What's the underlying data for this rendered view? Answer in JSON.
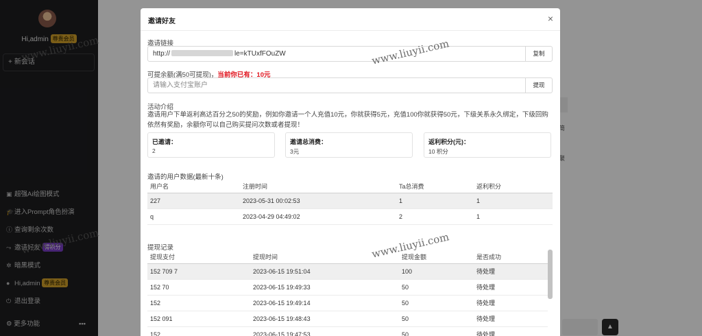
{
  "sidebar": {
    "username": "Hi,admin",
    "user_badge": "尊贵会员",
    "new_chat": "新会话",
    "menu": [
      {
        "icon": "image-icon",
        "glyph": "▣",
        "label": "超强Ai绘图模式"
      },
      {
        "icon": "graduation-cap-icon",
        "glyph": "🎓",
        "label": "进入Prompt角色扮演"
      },
      {
        "icon": "info-icon",
        "glyph": "ⓘ",
        "label": "查询剩余次数"
      },
      {
        "icon": "share-icon",
        "glyph": "⤳",
        "label": "邀请好友",
        "badge": "得积分"
      },
      {
        "icon": "moon-icon",
        "glyph": "✲",
        "label": "暗黑模式"
      },
      {
        "icon": "user-icon",
        "glyph": "●",
        "label": "Hi,admin",
        "badge": "尊贵会员"
      },
      {
        "icon": "power-icon",
        "glyph": "⏻",
        "label": "退出登录"
      }
    ],
    "more": "更多功能",
    "more_dots": "•••"
  },
  "background": {
    "text1": "简",
    "text2": "聚"
  },
  "modal": {
    "title": "邀请好友",
    "close": "×",
    "invite_link_label": "邀请链接",
    "invite_link_prefix": "http://",
    "invite_link_suffix": "le=kTUxfFOuZW",
    "copy_button": "复制",
    "withdraw_label": "可提余额(满50可提现)，",
    "withdraw_current": "当前你已有：10元",
    "alipay_placeholder": "请输入支付宝账户",
    "withdraw_button": "提现",
    "intro_title": "活动介绍",
    "intro_text": "邀请用户下单返利高达百分之50的奖励，例如你邀请一个人充值10元，你就获得5元，充值100你就获得50元，下级关系永久绑定，下级回购依然有奖励，余额你可以自己购买提问次数或者提现！",
    "stats": [
      {
        "title": "已邀请：",
        "value": "2"
      },
      {
        "title": "邀请总消费：",
        "value": "3元"
      },
      {
        "title": "返利积分(元)：",
        "value": "10 积分"
      }
    ],
    "users_title": "邀请的用户数据(最新十条)",
    "users_table": {
      "headers": [
        "用户名",
        "注册时间",
        "Ta总消费",
        "返利积分"
      ],
      "rows": [
        [
          "227",
          "2023-05-31 00:02:53",
          "1",
          "1"
        ],
        [
          "q",
          "2023-04-29 04:49:02",
          "2",
          "1"
        ]
      ]
    },
    "withdraw_title": "提现记录",
    "withdraw_table": {
      "headers": [
        "提现支付",
        "提现时间",
        "提现金额",
        "是否成功"
      ],
      "rows": [
        [
          "152  709  7",
          "2023-06-15 19:51:04",
          "100",
          "待处理"
        ],
        [
          "152  70",
          "2023-06-15 19:49:33",
          "50",
          "待处理"
        ],
        [
          "152",
          "2023-06-15 19:49:14",
          "50",
          "待处理"
        ],
        [
          "152  091",
          "2023-06-15 19:48:43",
          "50",
          "待处理"
        ],
        [
          "152",
          "2023-06-15 19:47:53",
          "50",
          "待处理"
        ]
      ]
    }
  },
  "watermarks": [
    "www.liuyii.com",
    "www.liuyii.com",
    "www.liuyii.com",
    "www.liuyii.com"
  ],
  "colors": {
    "accent_red": "#e0141e",
    "badge_gold": "#d4a22a",
    "badge_purple": "#7b3fc8",
    "sidebar_bg": "#1e1e20"
  }
}
